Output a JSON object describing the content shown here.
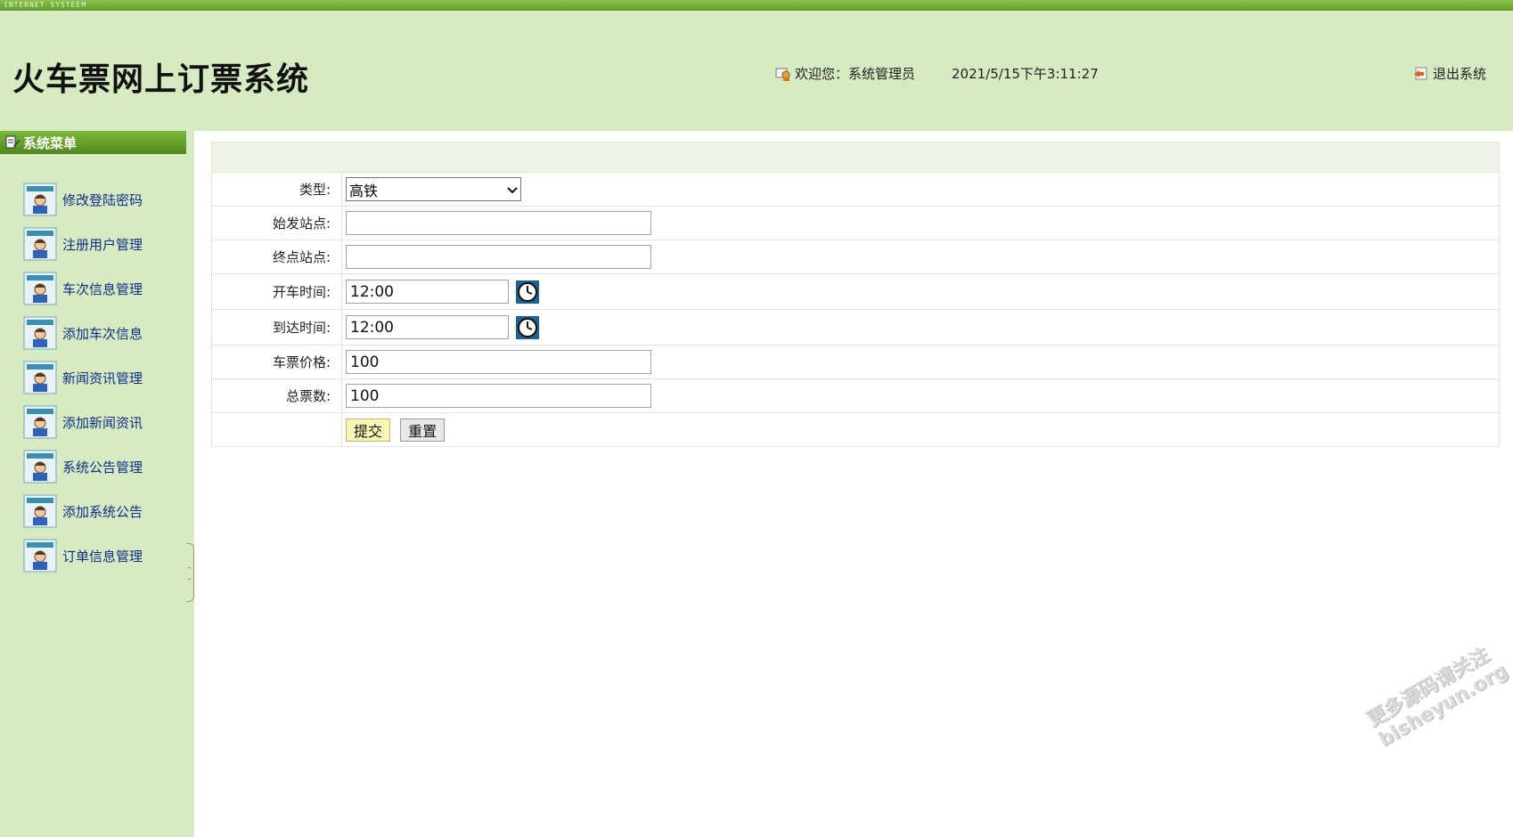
{
  "topbar": {
    "text": "INTERNET SYSTEEM"
  },
  "header": {
    "title": "火车票网上订票系统",
    "welcome": "欢迎您：系统管理员",
    "datetime": "2021/5/15下午3:11:27",
    "logout": "退出系统"
  },
  "sidebar": {
    "title": "系统菜单",
    "items": [
      {
        "label": "修改登陆密码"
      },
      {
        "label": "注册用户管理"
      },
      {
        "label": "车次信息管理"
      },
      {
        "label": "添加车次信息"
      },
      {
        "label": "新闻资讯管理"
      },
      {
        "label": "添加新闻资讯"
      },
      {
        "label": "系统公告管理"
      },
      {
        "label": "添加系统公告"
      },
      {
        "label": "订单信息管理"
      }
    ]
  },
  "form": {
    "type_label": "类型:",
    "type_value": "高铁",
    "start_label": "始发站点:",
    "start_value": "",
    "end_label": "终点站点:",
    "end_value": "",
    "depart_label": "开车时间:",
    "depart_value": "12:00",
    "arrive_label": "到达时间:",
    "arrive_value": "12:00",
    "price_label": "车票价格:",
    "price_value": "100",
    "total_label": "总票数:",
    "total_value": "100",
    "submit": "提交",
    "reset": "重置"
  },
  "watermark": {
    "line1": "更多源码请关注",
    "line2": "bisheyun.org"
  },
  "colors": {
    "header_bg": "#d6ebc1",
    "menu_head": "#5e9a26",
    "link": "#0f2d88"
  }
}
